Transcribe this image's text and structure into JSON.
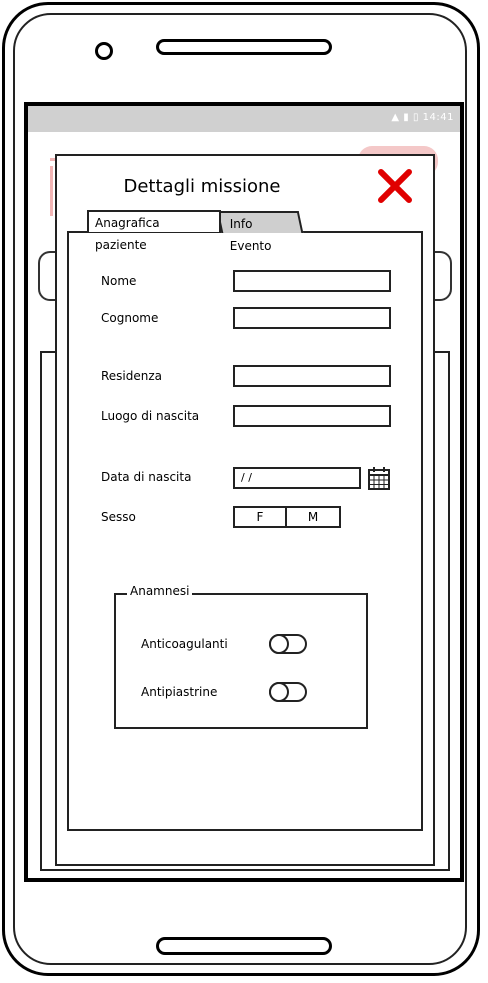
{
  "status_bar": {
    "icons": [
      "wifi-icon",
      "signal-icon",
      "battery-icon"
    ],
    "time": "14:41"
  },
  "dialog": {
    "title": "Dettagli missione",
    "close_icon": "close-icon",
    "close_color": "#e00000",
    "tabs": [
      {
        "label": "Anagrafica paziente",
        "active": true
      },
      {
        "label": "Info Evento",
        "active": false
      }
    ]
  },
  "form": {
    "nome": {
      "label": "Nome",
      "value": ""
    },
    "cognome": {
      "label": "Cognome",
      "value": ""
    },
    "residenza": {
      "label": "Residenza",
      "value": ""
    },
    "luogo_nascita": {
      "label": "Luogo di nascita",
      "value": ""
    },
    "data_nascita": {
      "label": "Data di nascita",
      "value": " /  /",
      "icon": "calendar-icon"
    },
    "sesso": {
      "label": "Sesso",
      "options": [
        "F",
        "M"
      ]
    }
  },
  "anamnesi": {
    "legend": "Anamnesi",
    "items": [
      {
        "label": "Anticoagulanti",
        "on": false
      },
      {
        "label": "Antipiastrine",
        "on": false
      }
    ]
  }
}
